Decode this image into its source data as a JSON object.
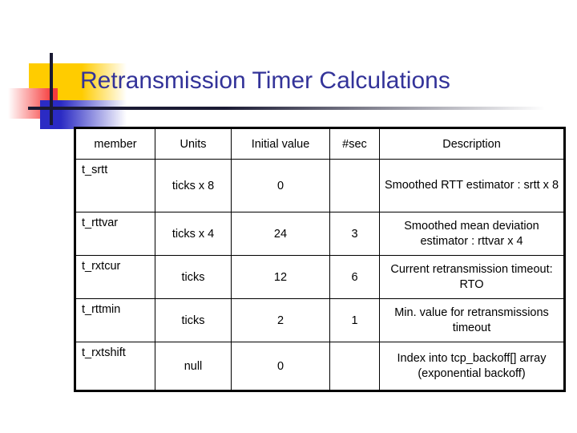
{
  "slide": {
    "title": "Retransmission Timer Calculations",
    "title_color": "#333399",
    "decor": {
      "yellow": "#ffcc00",
      "red": "#f63c3c",
      "blue": "#2b2bc4",
      "rule": "#1a1a33"
    }
  },
  "table": {
    "headers": {
      "member": "member",
      "units": "Units",
      "initial_value": "Initial value",
      "sec": "#sec",
      "description": "Description"
    },
    "rows": [
      {
        "member": "t_srtt",
        "units": "ticks x 8",
        "initial_value": "0",
        "sec": "",
        "description": "Smoothed RTT estimator : srtt x 8"
      },
      {
        "member": "t_rttvar",
        "units": "ticks x 4",
        "initial_value": "24",
        "sec": "3",
        "description": "Smoothed mean deviation estimator : rttvar x 4"
      },
      {
        "member": "t_rxtcur",
        "units": "ticks",
        "initial_value": "12",
        "sec": "6",
        "description": "Current retransmission timeout: RTO"
      },
      {
        "member": "t_rttmin",
        "units": "ticks",
        "initial_value": "2",
        "sec": "1",
        "description": "Min. value for retransmissions timeout"
      },
      {
        "member": "t_rxtshift",
        "units": "null",
        "initial_value": "0",
        "sec": "",
        "description": "Index into tcp_backoff[] array (exponential backoff)"
      }
    ]
  }
}
